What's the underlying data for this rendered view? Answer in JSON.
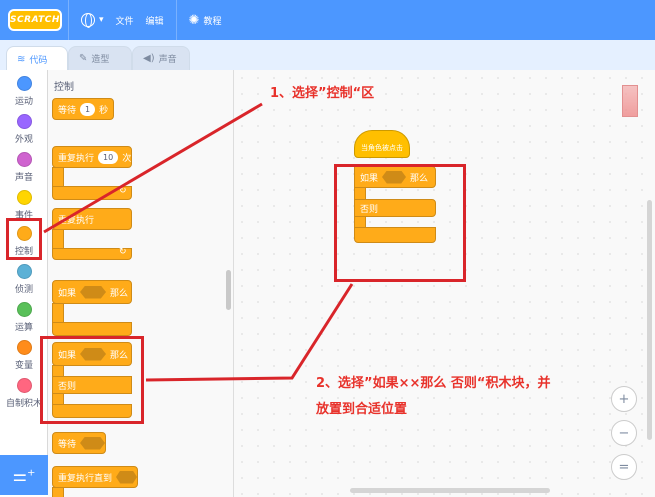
{
  "menu": {
    "logo": "SCRATCH",
    "file": "文件",
    "edit": "编辑",
    "tutorials": "教程"
  },
  "tabs": [
    {
      "label": "代码"
    },
    {
      "label": "造型"
    },
    {
      "label": "声音"
    }
  ],
  "categories": [
    {
      "label": "运动",
      "color": "#4c97ff"
    },
    {
      "label": "外观",
      "color": "#9966ff"
    },
    {
      "label": "声音",
      "color": "#cf63cf"
    },
    {
      "label": "事件",
      "color": "#ffd500"
    },
    {
      "label": "控制",
      "color": "#ffab19"
    },
    {
      "label": "侦测",
      "color": "#5cb1d6"
    },
    {
      "label": "运算",
      "color": "#59c059"
    },
    {
      "label": "变量",
      "color": "#ff8c1a"
    },
    {
      "label": "自制积木",
      "color": "#ff6680"
    }
  ],
  "palette": {
    "title": "控制",
    "wait_label": "等待",
    "wait_value": "1",
    "wait_unit": "秒",
    "repeat_label": "重复执行",
    "repeat_value": "10",
    "repeat_unit": "次",
    "forever_label": "重复执行",
    "if_label": "如果",
    "then_label": "那么",
    "if2_label": "如果",
    "then2_label": "那么",
    "else_label": "否则",
    "wait_until_label": "等待",
    "repeat_until_label": "重复执行直到"
  },
  "script": {
    "hat_label": "当角色被点击",
    "if_label": "如果",
    "then_label": "那么",
    "else_label": "否则"
  },
  "zoom": {
    "in": "+",
    "out": "−",
    "reset": "="
  },
  "annotations": {
    "note1": "1、选择”控制“区",
    "note2_line1": "2、选择”如果××那么  否则“积木块，并",
    "note2_line2": "放置到合适位置",
    "color": "#d9252a"
  }
}
